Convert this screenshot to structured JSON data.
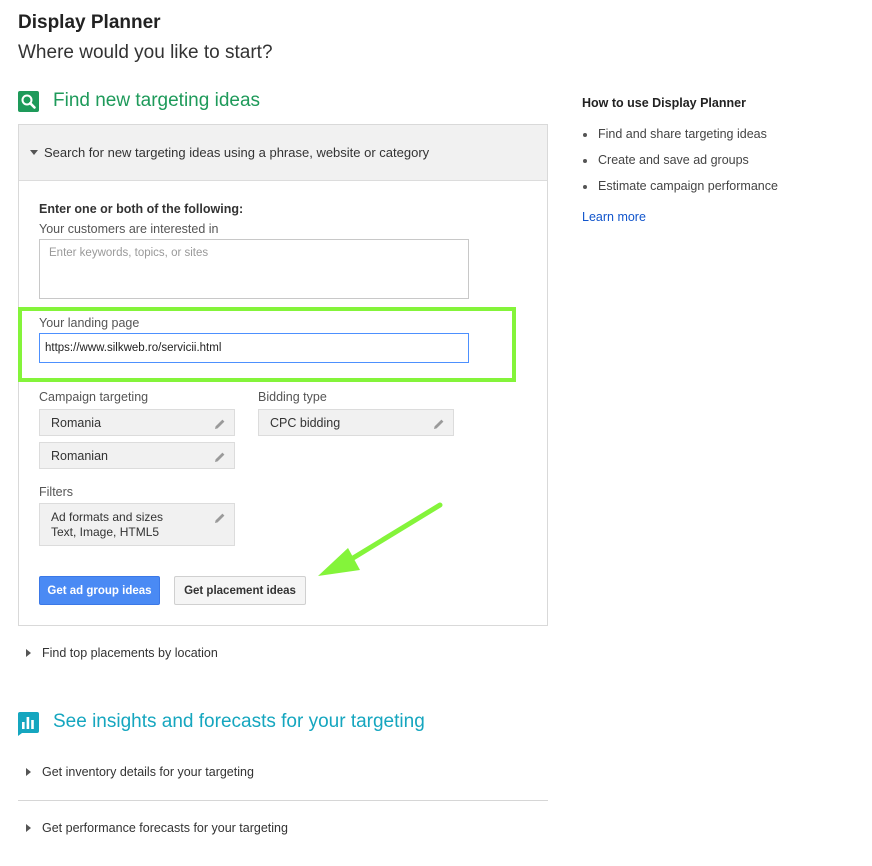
{
  "header": {
    "title": "Display Planner",
    "subtitle": "Where would you like to start?"
  },
  "find_section": {
    "title": "Find new targeting ideas",
    "icon": "search-icon",
    "accent": "#1e9a5a",
    "panel_header": "Search for new targeting ideas using a phrase, website or category",
    "instruction": "Enter one or both of the following:",
    "interests_label": "Your customers are interested in",
    "interests_placeholder": "Enter keywords, topics, or sites",
    "landing_label": "Your landing page",
    "landing_value": "https://www.silkweb.ro/servicii.html",
    "campaign_targeting_label": "Campaign targeting",
    "location_value": "Romania",
    "language_value": "Romanian",
    "bidding_label": "Bidding type",
    "bidding_value": "CPC bidding",
    "filters_label": "Filters",
    "filter_title": "Ad formats and sizes",
    "filter_value": "Text, Image, HTML5",
    "primary_button": "Get ad group ideas",
    "secondary_button": "Get placement ideas",
    "location_row": "Find top placements by location"
  },
  "insights_section": {
    "title": "See insights and forecasts for your targeting",
    "icon": "bar-chart-icon",
    "accent": "#15a6bf",
    "rows": [
      "Get inventory details for your targeting",
      "Get performance forecasts for your targeting"
    ]
  },
  "sidebar": {
    "title": "How to use Display Planner",
    "items": [
      "Find and share targeting ideas",
      "Create and save ad groups",
      "Estimate campaign performance"
    ],
    "learn_more": "Learn more"
  },
  "annotations": {
    "highlight_color": "#84f43a",
    "arrow_color": "#84f43a"
  }
}
